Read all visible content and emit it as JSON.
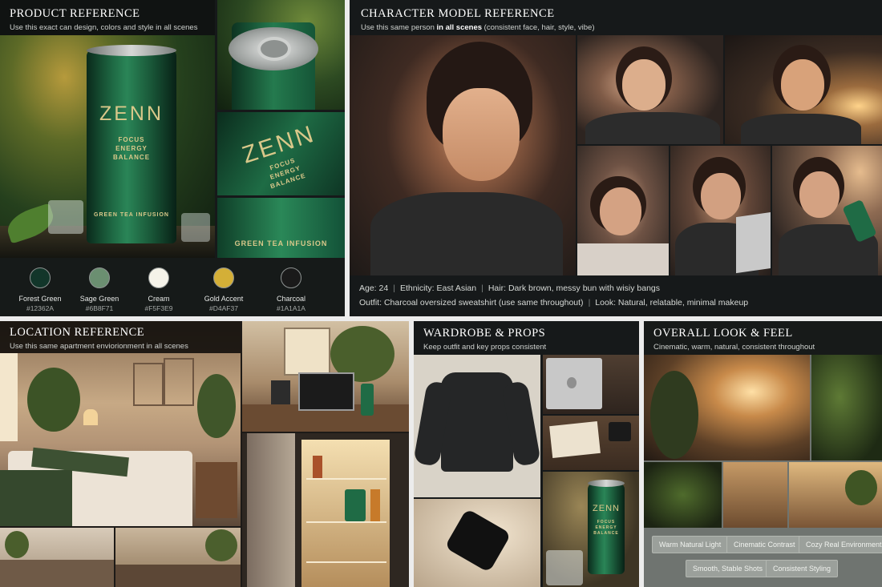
{
  "product": {
    "title": "PRODUCT REFERENCE",
    "subtitle": "Use this exact can design, colors and style in all scenes",
    "can": {
      "brand": "ZENN",
      "line1": "FOCUS",
      "line2": "ENERGY",
      "line3": "BALANCE",
      "flavor": "GREEN TEA INFUSION"
    },
    "swatches": [
      {
        "name": "Forest Green",
        "hex": "#12362A"
      },
      {
        "name": "Sage Green",
        "hex": "#6B8F71"
      },
      {
        "name": "Cream",
        "hex": "#F5F3E9"
      },
      {
        "name": "Gold Accent",
        "hex": "#D4AF37"
      },
      {
        "name": "Charcoal",
        "hex": "#1A1A1A"
      }
    ]
  },
  "character": {
    "title": "CHARACTER MODEL REFERENCE",
    "subtitle_pre": "Use this same person ",
    "subtitle_bold": "in all scenes",
    "subtitle_post": " (consistent face, hair, style, vibe)",
    "age_label": "Age:",
    "age": "24",
    "ethnicity_label": "Ethnicity:",
    "ethnicity": "East Asian",
    "hair_label": "Hair:",
    "hair": "Dark brown, messy bun with wisiy bangs",
    "outfit_label": "Outfit:",
    "outfit": "Charcoal oversized sweatshirt (use same throughout)",
    "look_label": "Look:",
    "look": "Natural, relatable, minimal makeup",
    "separator": "|"
  },
  "location": {
    "title": "LOCATION REFERENCE",
    "subtitle": "Use this same apartment enviorionment in all scenes"
  },
  "wardrobe": {
    "title": "WARDROBE & PROPS",
    "subtitle": "Keep outfit and key props consistent",
    "can": {
      "brand": "ZENN",
      "line1": "FOCUS",
      "line2": "ENERGY",
      "line3": "BALANCE"
    }
  },
  "overall": {
    "title": "OVERALL LOOK & FEEL",
    "subtitle": "Cinematic, warm, natural, consistent throughout",
    "tags": [
      "Warm Natural Light",
      "Cinematic Contrast",
      "Cozy Real Environment",
      "Smooth, Stable Shots",
      "Consistent Styling"
    ]
  },
  "colors": {
    "forest": "#12362A",
    "sage": "#6B8F71",
    "cream": "#F5F3E9",
    "gold": "#D4AF37",
    "charcoal": "#1A1A1A"
  }
}
